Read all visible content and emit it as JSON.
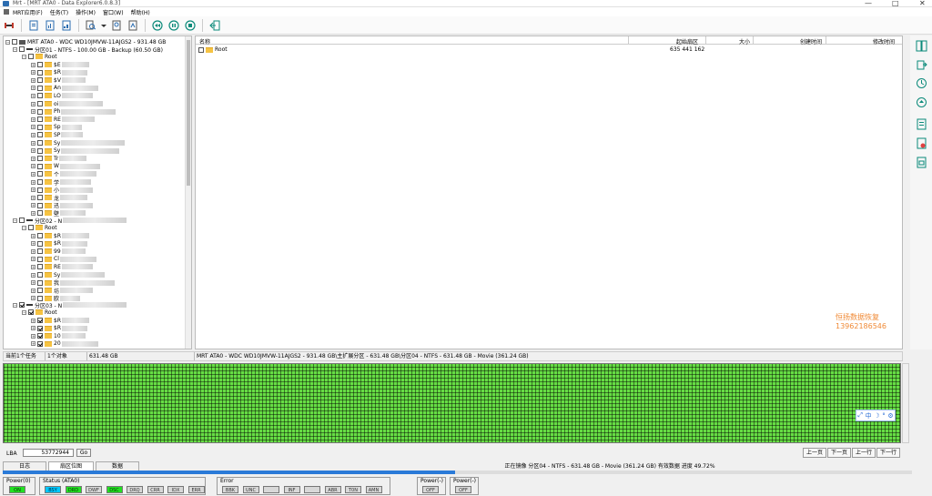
{
  "window": {
    "title": "Mrt - [MRT ATA0 - Data Explorer6.0.8.3]",
    "min": "—",
    "max": "□",
    "close": "✕"
  },
  "menu": [
    "MRT应用(F)",
    "任务(T)",
    "操作(M)",
    "窗口(W)",
    "帮助(H)"
  ],
  "tree": {
    "disk": "MRT ATA0 - WDC WD10JMVW-11AJGS2 - 931.48 GB",
    "p1": "分区01 - NTFS - 100.00 GB - Backup (60.50 GB)",
    "root": "Root",
    "p1_items": [
      "$E",
      "$R",
      "$V",
      "An",
      "LO",
      "oi",
      "Ph",
      "RE",
      "Sp",
      "SP",
      "Sy",
      "Sy",
      "Tr",
      "W",
      "个",
      "学",
      "小",
      "龙",
      "迅",
      "壁"
    ],
    "p2": "分区02 - N",
    "p2_items": [
      "$R",
      "$R",
      "99",
      "Cl",
      "RE",
      "Sy",
      "我",
      "坊",
      "欧"
    ],
    "p3": "分区03 - N",
    "p3_items": [
      "$R",
      "$R",
      "10",
      "20"
    ]
  },
  "list": {
    "headers": {
      "name": "名称",
      "start": "起始扇区",
      "size": "大小",
      "created": "创建时间",
      "modified": "修改时间"
    },
    "rows": [
      {
        "name": "Root",
        "start": "635 441 162"
      }
    ]
  },
  "watermark": {
    "line1": "恒扬数据恢复",
    "line2": "13962186546"
  },
  "status": {
    "tasks": "当前1个任务",
    "objects": "1个对象",
    "size": "631.48 GB",
    "path": "MRT ATA0 - WDC WD10JMVW-11AJGS2 - 931.48 GB\\主扩展分区 - 631.48 GB\\分区04 - NTFS - 631.48 GB - Movie (361.24 GB)"
  },
  "lba": {
    "label": "LBA",
    "value": "53772944",
    "go": "Go",
    "prev_page": "上一页",
    "next_page": "下一页",
    "prev_row": "上一行",
    "next_row": "下一行"
  },
  "tabs": [
    "日志",
    "扇区位图",
    "数据"
  ],
  "progress": {
    "text": "正在镜像 分区04 - NTFS - 631.48 GB - Movie (361.24 GB) 有效数据  进度 49.72%",
    "fraction": 0.4972
  },
  "ime": {
    "lang": "中"
  },
  "panels": {
    "power0": {
      "title": "Power(0)",
      "leds": [
        "ON"
      ]
    },
    "status": {
      "title": "Status (ATA0)",
      "leds": [
        "BSY",
        "DRD",
        "DWF",
        "DSC",
        "DRQ",
        "CRR",
        "IDX",
        "ERR"
      ]
    },
    "error": {
      "title": "Error",
      "leds": [
        "BBK",
        "UNC",
        "",
        "INF",
        "",
        "ABR",
        "T0N",
        "AMN"
      ]
    },
    "power1": {
      "title": "Power(-)",
      "leds": [
        "OFF"
      ]
    },
    "power2": {
      "title": "Power(-)",
      "leds": [
        "OFF"
      ]
    }
  },
  "colors": {
    "accent": "#2a7ad8",
    "map_green": "#66dd44",
    "led_green": "#22e022",
    "led_cyan": "#00c8ff",
    "watermark": "#f08a36"
  }
}
